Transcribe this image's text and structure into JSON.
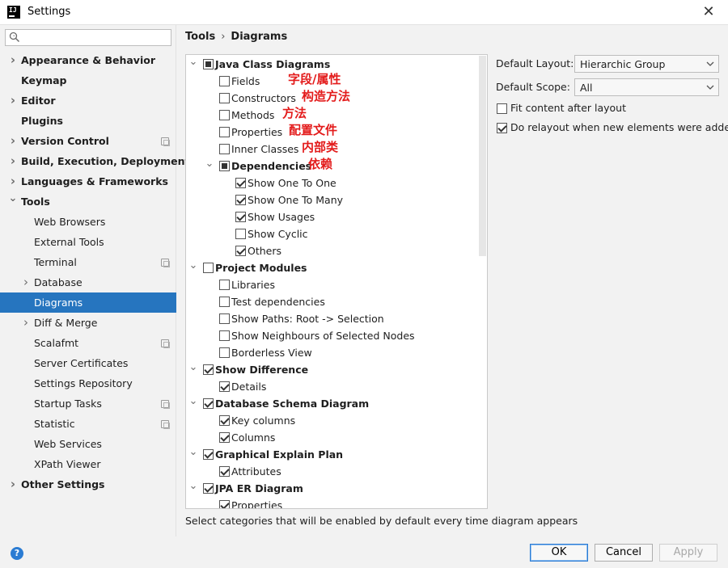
{
  "window": {
    "title": "Settings",
    "logo_text": "IJ",
    "close_symbol": "✕"
  },
  "search": {
    "placeholder": "",
    "value": ""
  },
  "sidebar": {
    "items": [
      {
        "label": "Appearance & Behavior",
        "bold": true,
        "expand": "collapsed",
        "level": 0
      },
      {
        "label": "Keymap",
        "bold": true,
        "expand": "none",
        "level": 0
      },
      {
        "label": "Editor",
        "bold": true,
        "expand": "collapsed",
        "level": 0
      },
      {
        "label": "Plugins",
        "bold": true,
        "expand": "none",
        "level": 0
      },
      {
        "label": "Version Control",
        "bold": true,
        "expand": "collapsed",
        "level": 0,
        "project_icon": true
      },
      {
        "label": "Build, Execution, Deployment",
        "bold": true,
        "expand": "collapsed",
        "level": 0
      },
      {
        "label": "Languages & Frameworks",
        "bold": true,
        "expand": "collapsed",
        "level": 0
      },
      {
        "label": "Tools",
        "bold": true,
        "expand": "expanded",
        "level": 0
      },
      {
        "label": "Web Browsers",
        "bold": false,
        "expand": "none",
        "level": 1
      },
      {
        "label": "External Tools",
        "bold": false,
        "expand": "none",
        "level": 1
      },
      {
        "label": "Terminal",
        "bold": false,
        "expand": "none",
        "level": 1,
        "project_icon": true
      },
      {
        "label": "Database",
        "bold": false,
        "expand": "collapsed",
        "level": 1
      },
      {
        "label": "Diagrams",
        "bold": false,
        "expand": "none",
        "level": 1,
        "selected": true
      },
      {
        "label": "Diff & Merge",
        "bold": false,
        "expand": "collapsed",
        "level": 1
      },
      {
        "label": "Scalafmt",
        "bold": false,
        "expand": "none",
        "level": 1,
        "project_icon": true
      },
      {
        "label": "Server Certificates",
        "bold": false,
        "expand": "none",
        "level": 1
      },
      {
        "label": "Settings Repository",
        "bold": false,
        "expand": "none",
        "level": 1
      },
      {
        "label": "Startup Tasks",
        "bold": false,
        "expand": "none",
        "level": 1,
        "project_icon": true
      },
      {
        "label": "Statistic",
        "bold": false,
        "expand": "none",
        "level": 1,
        "project_icon": true
      },
      {
        "label": "Web Services",
        "bold": false,
        "expand": "none",
        "level": 1
      },
      {
        "label": "XPath Viewer",
        "bold": false,
        "expand": "none",
        "level": 1
      },
      {
        "label": "Other Settings",
        "bold": true,
        "expand": "collapsed",
        "level": 0
      }
    ]
  },
  "breadcrumb": {
    "parent": "Tools",
    "separator": "›",
    "current": "Diagrams"
  },
  "tree": {
    "rows": [
      {
        "label": "Java Class Diagrams",
        "level": 0,
        "state": "partial",
        "bold": true,
        "expand": "expanded"
      },
      {
        "label": "Fields",
        "level": 1,
        "state": "unchecked",
        "bold": false,
        "expand": "none",
        "note": "字段/属性"
      },
      {
        "label": "Constructors",
        "level": 1,
        "state": "unchecked",
        "bold": false,
        "expand": "none",
        "note": "构造方法"
      },
      {
        "label": "Methods",
        "level": 1,
        "state": "unchecked",
        "bold": false,
        "expand": "none",
        "note": "方法"
      },
      {
        "label": "Properties",
        "level": 1,
        "state": "unchecked",
        "bold": false,
        "expand": "none",
        "note": "配置文件"
      },
      {
        "label": "Inner Classes",
        "level": 1,
        "state": "unchecked",
        "bold": false,
        "expand": "none",
        "note": "内部类"
      },
      {
        "label": "Dependencies",
        "level": 1,
        "state": "partial",
        "bold": true,
        "expand": "expanded",
        "note": "依赖"
      },
      {
        "label": "Show One To One",
        "level": 2,
        "state": "checked",
        "bold": false,
        "expand": "none"
      },
      {
        "label": "Show One To Many",
        "level": 2,
        "state": "checked",
        "bold": false,
        "expand": "none"
      },
      {
        "label": "Show Usages",
        "level": 2,
        "state": "checked",
        "bold": false,
        "expand": "none"
      },
      {
        "label": "Show Cyclic",
        "level": 2,
        "state": "unchecked",
        "bold": false,
        "expand": "none"
      },
      {
        "label": "Others",
        "level": 2,
        "state": "checked",
        "bold": false,
        "expand": "none"
      },
      {
        "label": "Project Modules",
        "level": 0,
        "state": "unchecked",
        "bold": true,
        "expand": "expanded"
      },
      {
        "label": "Libraries",
        "level": 1,
        "state": "unchecked",
        "bold": false,
        "expand": "none"
      },
      {
        "label": "Test dependencies",
        "level": 1,
        "state": "unchecked",
        "bold": false,
        "expand": "none"
      },
      {
        "label": "Show Paths: Root -> Selection",
        "level": 1,
        "state": "unchecked",
        "bold": false,
        "expand": "none"
      },
      {
        "label": "Show Neighbours of Selected Nodes",
        "level": 1,
        "state": "unchecked",
        "bold": false,
        "expand": "none"
      },
      {
        "label": "Borderless View",
        "level": 1,
        "state": "unchecked",
        "bold": false,
        "expand": "none"
      },
      {
        "label": "Show Difference",
        "level": 0,
        "state": "checked",
        "bold": true,
        "expand": "expanded"
      },
      {
        "label": "Details",
        "level": 1,
        "state": "checked",
        "bold": false,
        "expand": "none"
      },
      {
        "label": "Database Schema Diagram",
        "level": 0,
        "state": "checked",
        "bold": true,
        "expand": "expanded"
      },
      {
        "label": "Key columns",
        "level": 1,
        "state": "checked",
        "bold": false,
        "expand": "none"
      },
      {
        "label": "Columns",
        "level": 1,
        "state": "checked",
        "bold": false,
        "expand": "none"
      },
      {
        "label": "Graphical Explain Plan",
        "level": 0,
        "state": "checked",
        "bold": true,
        "expand": "expanded"
      },
      {
        "label": "Attributes",
        "level": 1,
        "state": "checked",
        "bold": false,
        "expand": "none"
      },
      {
        "label": "JPA ER Diagram",
        "level": 0,
        "state": "checked",
        "bold": true,
        "expand": "expanded"
      },
      {
        "label": "Properties",
        "level": 1,
        "state": "checked",
        "bold": false,
        "expand": "none"
      }
    ]
  },
  "hint": "Select categories that will be enabled by default every time diagram appears",
  "options": {
    "default_layout_label": "Default Layout:",
    "default_layout_value": "Hierarchic Group",
    "default_scope_label": "Default Scope:",
    "default_scope_value": "All",
    "fit_content": {
      "label": "Fit content after layout",
      "checked": false
    },
    "relayout": {
      "label": "Do relayout when new elements were added",
      "checked": true
    }
  },
  "footer": {
    "help": "?",
    "ok": "OK",
    "cancel": "Cancel",
    "apply": "Apply"
  },
  "colors": {
    "selection": "#2675bf",
    "annotation": "#e31b1b",
    "help": "#2b7cd3"
  }
}
